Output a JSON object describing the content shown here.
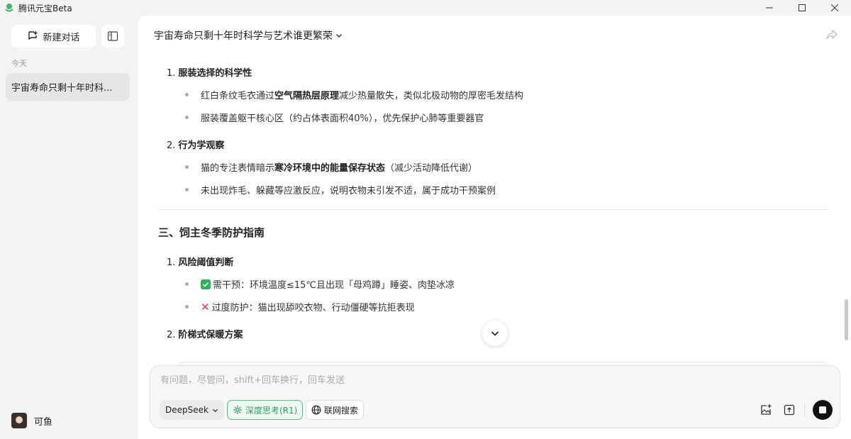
{
  "app": {
    "title": "腾讯元宝Beta",
    "window_controls": [
      "minimize-icon",
      "maximize-icon",
      "close-icon"
    ]
  },
  "sidebar": {
    "new_chat_label": "新建对话",
    "section_today": "今天",
    "history": [
      {
        "label": "宇宙寿命只剩十年时科..."
      }
    ],
    "user_name": "可鱼"
  },
  "chat": {
    "title": "宇宙寿命只剩十年时科学与艺术谁更繁荣",
    "items": [
      {
        "num": "1.",
        "heading": "服装选择的科学性",
        "bullets": [
          {
            "pre": "红白条纹毛衣通过",
            "bold": "空气隔热层原理",
            "post": "减少热量散失，类似北极动物的厚密毛发结构"
          },
          {
            "pre": "服装覆盖躯干核心区（约占体表面积40%），优先保护心肺等重要器官",
            "bold": "",
            "post": ""
          }
        ]
      },
      {
        "num": "2.",
        "heading": "行为学观察",
        "bullets": [
          {
            "pre": "猫的专注表情暗示",
            "bold": "寒冷环境中的能量保存状态",
            "post": "（减少活动降低代谢）"
          },
          {
            "pre": "未出现炸毛、躲藏等应激反应，说明衣物未引发不适，属于成功干预案例",
            "bold": "",
            "post": ""
          }
        ]
      }
    ],
    "section3_heading": "三、饲主冬季防护指南",
    "section3_items": [
      {
        "num": "1.",
        "heading": "风险阈值判断",
        "bullets": [
          {
            "icon": "check-icon",
            "text": "需干预：环境温度≤15℃且出现「母鸡蹲」睡姿、肉垫冰凉"
          },
          {
            "icon": "cross-icon",
            "text": "过度防护：猫出现舔咬衣物、行动僵硬等抗拒表现"
          }
        ]
      },
      {
        "num": "2.",
        "heading": "阶梯式保暖方案"
      }
    ]
  },
  "composer": {
    "placeholder": "有问题，尽管问，shift+回车换行，回车发送",
    "model": "DeepSeek",
    "deep_think": "深度思考(R1)",
    "web_search": "联网搜索"
  },
  "colors": {
    "accent_green": "#2f9c66",
    "check_green": "#2fb05a",
    "cross_red": "#e2344f"
  }
}
